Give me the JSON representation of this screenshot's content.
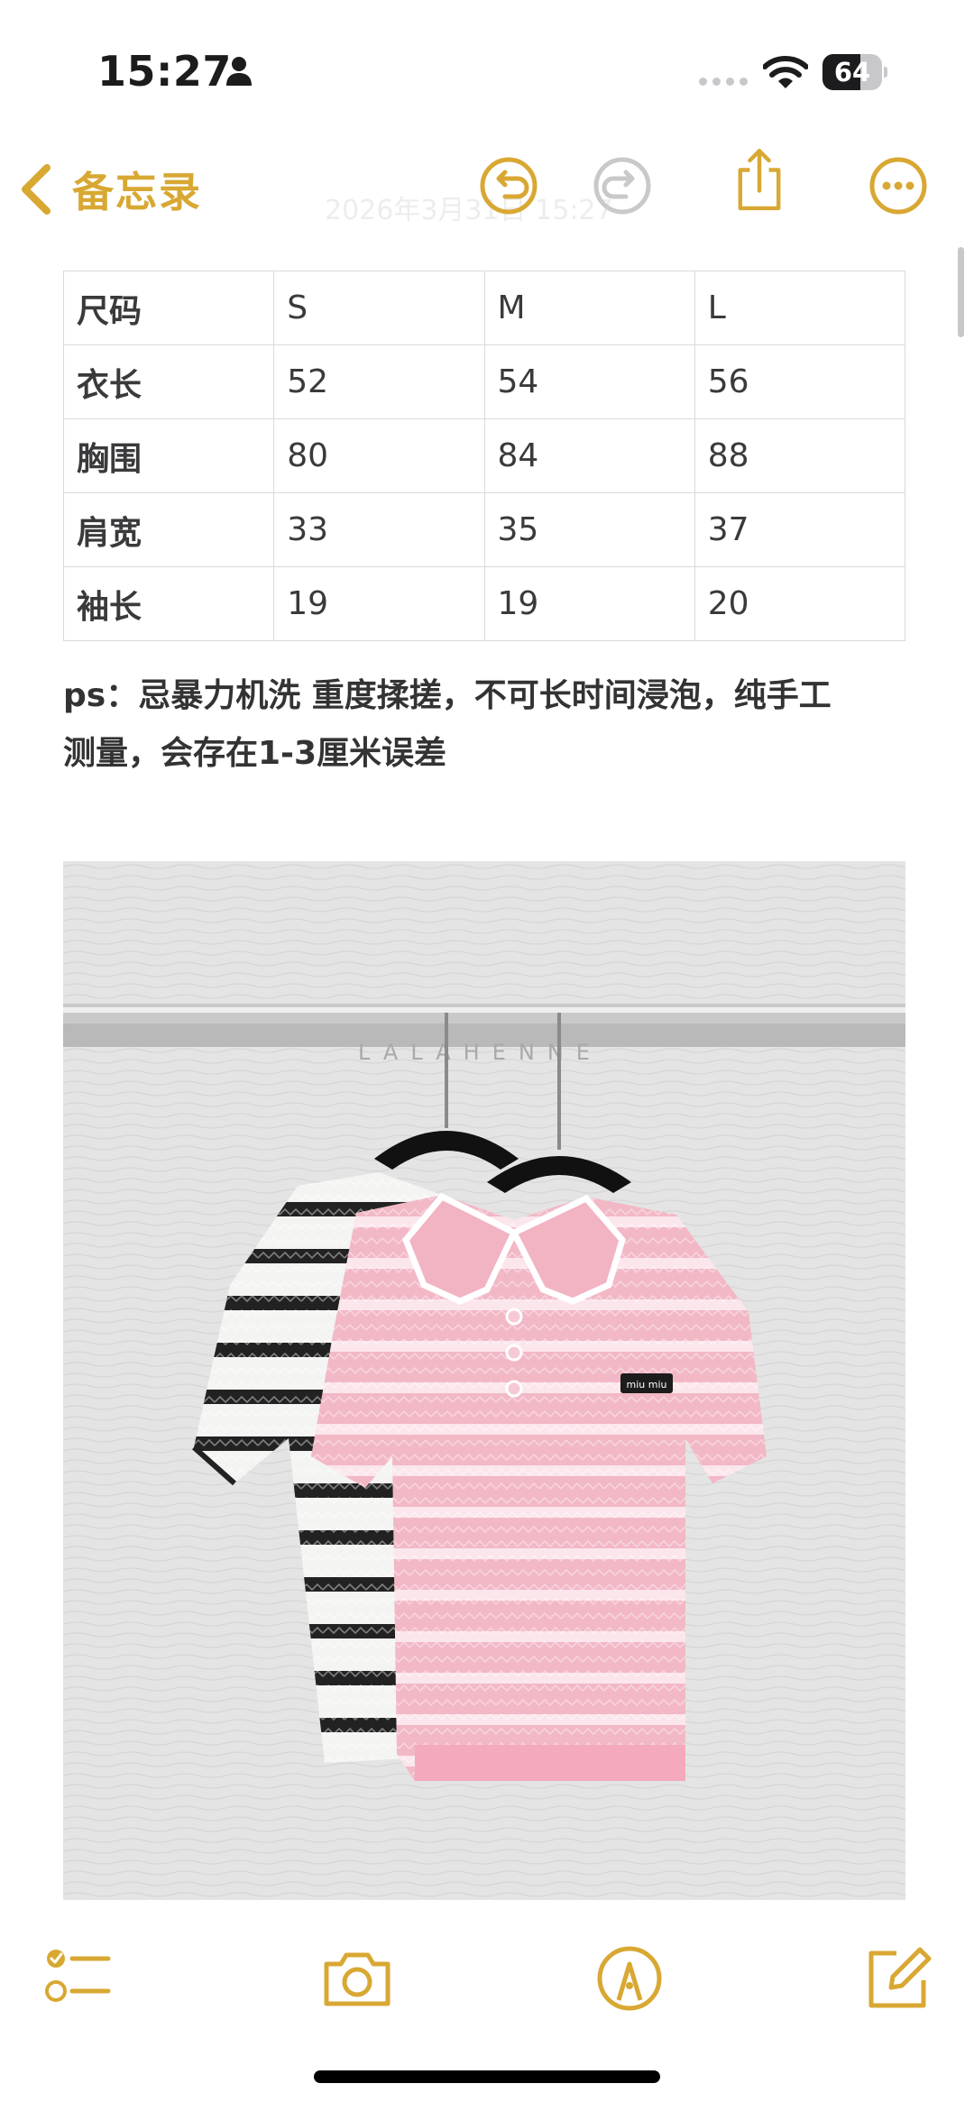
{
  "status_bar": {
    "time": "15:27",
    "battery_level": "64",
    "battery_fraction": 0.64
  },
  "nav": {
    "back_label": "备忘录",
    "faded_title": "2026年3月31日 15:27",
    "icons": [
      "chevron-left-icon",
      "undo-icon",
      "redo-icon",
      "share-icon",
      "more-icon"
    ]
  },
  "size_table": {
    "rows": [
      [
        "尺码",
        "S",
        "M",
        "L"
      ],
      [
        "衣长",
        "52",
        "54",
        "56"
      ],
      [
        "胸围",
        "80",
        "84",
        "88"
      ],
      [
        "肩宽",
        "33",
        "35",
        "37"
      ],
      [
        "袖长",
        "19",
        "19",
        "20"
      ]
    ]
  },
  "note": {
    "line1": "ps：忌暴力机洗 重度揉搓，不可长时间浸泡，纯手工",
    "line2": "测量，会存在1-3厘米误差"
  },
  "photo": {
    "watermark": "LALAHENNE",
    "logo_text": "miu miu"
  },
  "toolbar": {
    "icons": [
      "checklist-icon",
      "camera-icon",
      "markup-icon",
      "compose-icon"
    ]
  },
  "colors": {
    "accent": "#d8a833",
    "table_border": "#d9d9d9",
    "text": "#333333"
  }
}
